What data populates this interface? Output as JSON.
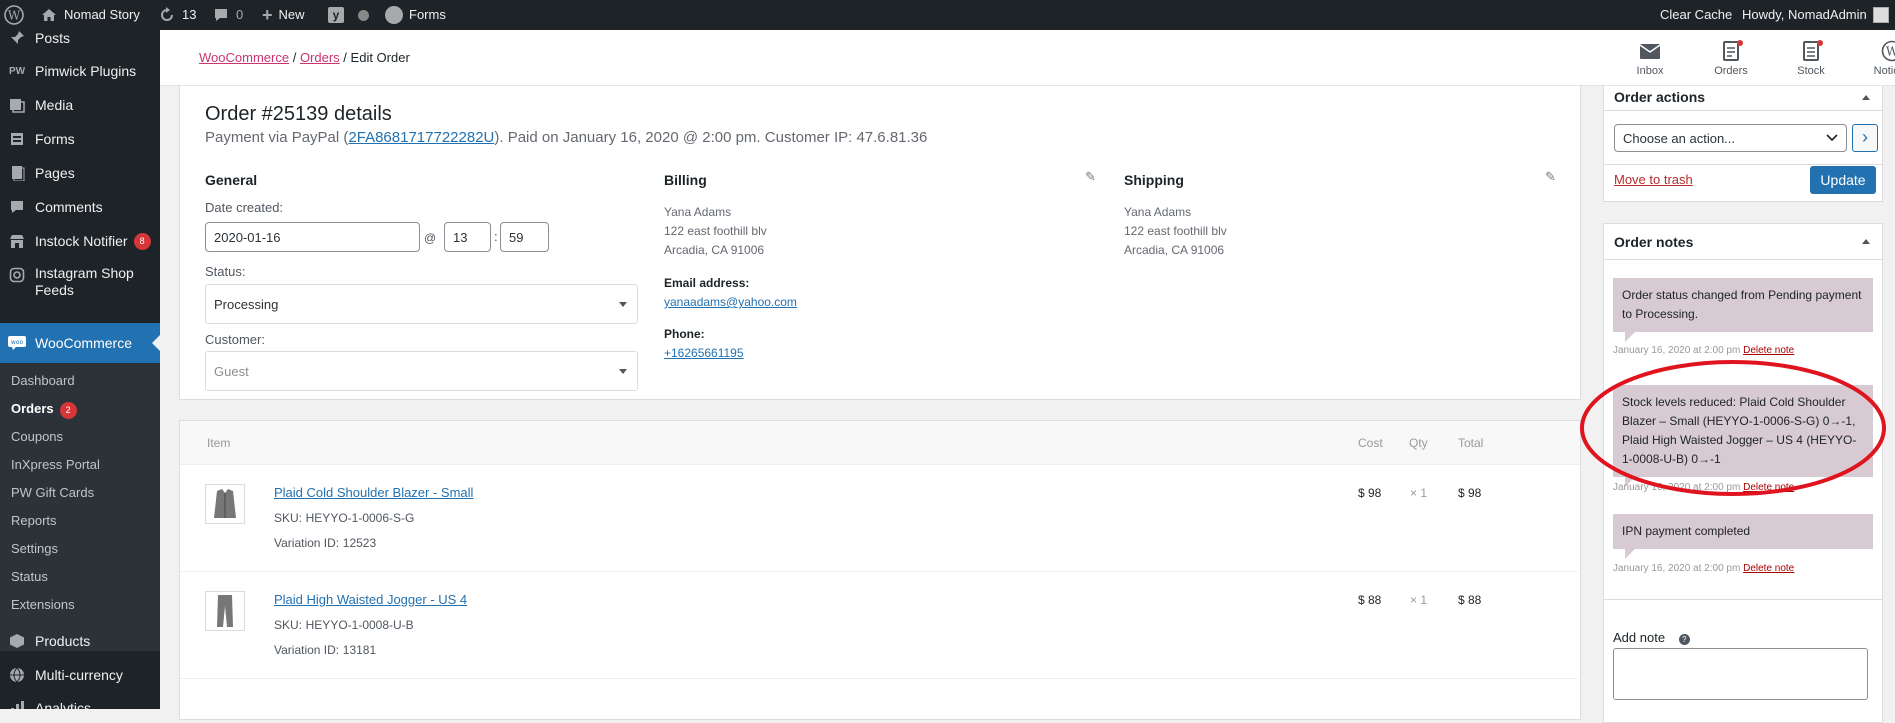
{
  "admin_bar": {
    "site_name": "Nomad Story",
    "updates_count": "13",
    "comments_count": "0",
    "new_label": "New",
    "forms_label": "Forms",
    "clear_cache": "Clear Cache",
    "howdy": "Howdy, NomadAdmin"
  },
  "sidebar": {
    "items": [
      {
        "label": "Posts",
        "icon": "pin-icon"
      },
      {
        "label": "Pimwick Plugins",
        "icon": "pw-icon"
      },
      {
        "label": "Media",
        "icon": "media-icon"
      },
      {
        "label": "Forms",
        "icon": "forms-icon"
      },
      {
        "label": "Pages",
        "icon": "pages-icon"
      },
      {
        "label": "Comments",
        "icon": "comments-icon"
      },
      {
        "label": "Instock Notifier",
        "icon": "store-icon",
        "badge": "8"
      },
      {
        "label": "Instagram Shop Feeds",
        "icon": "instagram-icon"
      },
      {
        "label": "WooCommerce",
        "icon": "woo-icon"
      }
    ],
    "submenu": [
      {
        "label": "Dashboard"
      },
      {
        "label": "Orders",
        "badge": "2"
      },
      {
        "label": "Coupons"
      },
      {
        "label": "InXpress Portal"
      },
      {
        "label": "PW Gift Cards"
      },
      {
        "label": "Reports"
      },
      {
        "label": "Settings"
      },
      {
        "label": "Status"
      },
      {
        "label": "Extensions"
      }
    ],
    "bottom_items": [
      {
        "label": "Products",
        "icon": "products-icon"
      },
      {
        "label": "Multi-currency",
        "icon": "globe-icon"
      },
      {
        "label": "Analytics",
        "icon": "analytics-icon"
      }
    ]
  },
  "header": {
    "breadcrumb": [
      "WooCommerce",
      "Orders",
      "Edit Order"
    ],
    "separator": "/",
    "buttons": [
      {
        "label": "Inbox",
        "icon": "inbox-icon"
      },
      {
        "label": "Orders",
        "icon": "orders-icon"
      },
      {
        "label": "Stock",
        "icon": "stock-icon"
      },
      {
        "label": "Notices",
        "icon": "wordpress-icon"
      }
    ]
  },
  "order": {
    "title": "Order #25139 details",
    "payment_prefix": "Payment via PayPal (",
    "transaction_id": "2FA8681717722282U",
    "payment_suffix": "). Paid on January 16, 2020 @ 2:00 pm. Customer IP: 47.6.81.36",
    "general": {
      "heading": "General",
      "date_label": "Date created:",
      "date": "2020-01-16",
      "at": "@",
      "hour": "13",
      "colon": ":",
      "minute": "59",
      "status_label": "Status:",
      "status": "Processing",
      "customer_label": "Customer:",
      "customer": "Guest"
    },
    "billing": {
      "heading": "Billing",
      "name": "Yana Adams",
      "street": "122 east foothill blv",
      "city": "Arcadia, CA 91006",
      "email_label": "Email address:",
      "email": "yanaadams@yahoo.com",
      "phone_label": "Phone:",
      "phone": "+16265661195"
    },
    "shipping": {
      "heading": "Shipping",
      "name": "Yana Adams",
      "street": "122 east foothill blv",
      "city": "Arcadia, CA 91006"
    }
  },
  "items_table": {
    "headers": {
      "item": "Item",
      "cost": "Cost",
      "qty": "Qty",
      "total": "Total"
    },
    "rows": [
      {
        "name": "Plaid Cold Shoulder Blazer - Small",
        "sku_label": "SKU:",
        "sku": "HEYYO-1-0006-S-G",
        "variation_label": "Variation ID:",
        "variation": "12523",
        "cost": "$ 98",
        "qty": "× 1",
        "total": "$ 98"
      },
      {
        "name": "Plaid High Waisted Jogger - US 4",
        "sku_label": "SKU:",
        "sku": "HEYYO-1-0008-U-B",
        "variation_label": "Variation ID:",
        "variation": "13181",
        "cost": "$ 88",
        "qty": "× 1",
        "total": "$ 88"
      }
    ]
  },
  "order_actions": {
    "title": "Order actions",
    "select": "Choose an action...",
    "go": "›",
    "trash": "Move to trash",
    "update": "Update"
  },
  "order_notes": {
    "title": "Order notes",
    "delete_label": "Delete note",
    "notes": [
      {
        "text": "Order status changed from Pending payment to Processing.",
        "meta": "January 16, 2020 at 2:00 pm"
      },
      {
        "text": "Stock levels reduced: Plaid Cold Shoulder Blazer – Small (HEYYO-1-0006-S-G) 0→-1, Plaid High Waisted Jogger – US 4 (HEYYO-1-0008-U-B) 0→-1",
        "meta": "January 16, 2020 at 2:00 pm"
      },
      {
        "text": "IPN payment completed",
        "meta": "January 16, 2020 at 2:00 pm"
      }
    ],
    "add_note_label": "Add note",
    "help": "?"
  },
  "colors": {
    "admin_dark": "#1d2327",
    "wp_blue": "#2271b1",
    "woo_pink": "#c9356e",
    "note_bg": "#d7cad2",
    "annotation_red": "#e0141e"
  }
}
